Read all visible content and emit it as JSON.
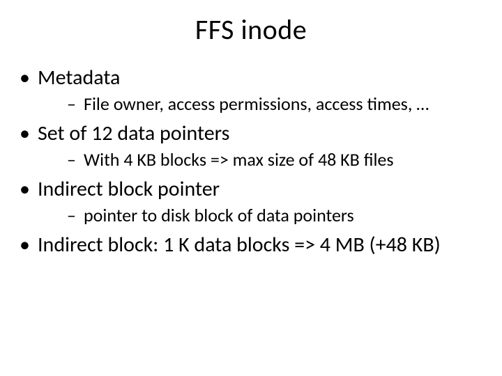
{
  "title": "FFS inode",
  "bullets": [
    {
      "text": "Metadata",
      "children": [
        "File owner, access permissions, access times, …"
      ]
    },
    {
      "text": "Set of 12 data pointers",
      "children": [
        "With 4 KB blocks => max size of 48 KB files"
      ]
    },
    {
      "text": "Indirect block pointer",
      "children": [
        "pointer to disk block of data pointers"
      ]
    },
    {
      "text": "Indirect block: 1 K data blocks => 4 MB (+48 KB)",
      "children": []
    }
  ]
}
